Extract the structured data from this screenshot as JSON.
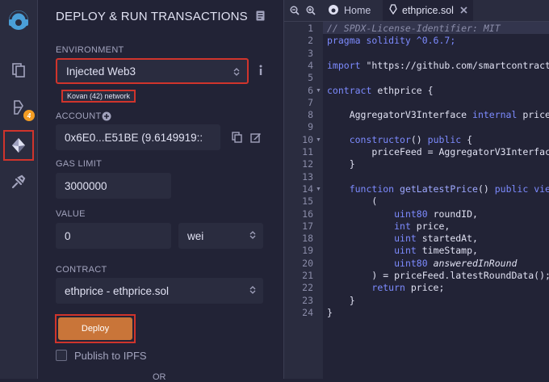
{
  "sidebar": {
    "icons": [
      "logo-icon",
      "file-explorer-icon",
      "compiler-icon",
      "deploy-run-icon",
      "plugin-icon"
    ],
    "compiler_badge": "4",
    "accent": "#c97539",
    "highlight": "#d0342c"
  },
  "panel": {
    "title": "DEPLOY & RUN TRANSACTIONS",
    "environment": {
      "label": "ENVIRONMENT",
      "value": "Injected Web3",
      "network": "Kovan (42) network"
    },
    "account": {
      "label": "ACCOUNT",
      "value": "0x6E0...E51BE (9.6149919::"
    },
    "gas_limit": {
      "label": "GAS LIMIT",
      "value": "3000000"
    },
    "value": {
      "label": "VALUE",
      "amount": "0",
      "unit": "wei"
    },
    "contract": {
      "label": "CONTRACT",
      "value": "ethprice - ethprice.sol"
    },
    "deploy_label": "Deploy",
    "publish_label": "Publish to IPFS",
    "or_label": "OR"
  },
  "editor": {
    "tabs": [
      {
        "label": "Home"
      },
      {
        "label": "ethprice.sol"
      }
    ],
    "line_numbers": [
      "1",
      "2",
      "3",
      "4",
      "5",
      "6",
      "7",
      "8",
      "9",
      "10",
      "11",
      "12",
      "13",
      "14",
      "15",
      "16",
      "17",
      "18",
      "19",
      "20",
      "21",
      "22",
      "23",
      "24"
    ],
    "lines": [
      {
        "parts": [
          {
            "t": "// SPDX-License-Identifier: MIT",
            "c": "cm"
          }
        ]
      },
      {
        "parts": [
          {
            "t": "pragma solidity",
            "c": "kw"
          },
          {
            "t": " ^0.6.7;",
            "c": "kw"
          }
        ]
      },
      {
        "parts": [
          {
            "t": "",
            "c": ""
          }
        ]
      },
      {
        "parts": [
          {
            "t": "import",
            "c": "kw"
          },
          {
            "t": " \"https://github.com/smartcontract",
            "c": ""
          }
        ]
      },
      {
        "parts": [
          {
            "t": "",
            "c": ""
          }
        ]
      },
      {
        "parts": [
          {
            "t": "contract",
            "c": "kw"
          },
          {
            "t": " ethprice {",
            "c": ""
          }
        ]
      },
      {
        "parts": [
          {
            "t": "",
            "c": ""
          }
        ]
      },
      {
        "parts": [
          {
            "t": "    AggregatorV3Interface ",
            "c": ""
          },
          {
            "t": "internal",
            "c": "kw"
          },
          {
            "t": " price",
            "c": ""
          }
        ]
      },
      {
        "parts": [
          {
            "t": "",
            "c": ""
          }
        ]
      },
      {
        "parts": [
          {
            "t": "    ",
            "c": ""
          },
          {
            "t": "constructor",
            "c": "kw"
          },
          {
            "t": "() ",
            "c": ""
          },
          {
            "t": "public",
            "c": "kw"
          },
          {
            "t": " {",
            "c": ""
          }
        ]
      },
      {
        "parts": [
          {
            "t": "        priceFeed = AggregatorV3Interfac",
            "c": ""
          }
        ]
      },
      {
        "parts": [
          {
            "t": "    }",
            "c": ""
          }
        ]
      },
      {
        "parts": [
          {
            "t": "",
            "c": ""
          }
        ]
      },
      {
        "parts": [
          {
            "t": "    ",
            "c": ""
          },
          {
            "t": "function",
            "c": "kw"
          },
          {
            "t": " getLatestPrice",
            "c": "ty"
          },
          {
            "t": "() ",
            "c": ""
          },
          {
            "t": "public",
            "c": "kw"
          },
          {
            "t": " vie",
            "c": "kw"
          }
        ]
      },
      {
        "parts": [
          {
            "t": "        (",
            "c": ""
          }
        ]
      },
      {
        "parts": [
          {
            "t": "            ",
            "c": ""
          },
          {
            "t": "uint80",
            "c": "kw"
          },
          {
            "t": " roundID,",
            "c": ""
          }
        ]
      },
      {
        "parts": [
          {
            "t": "            ",
            "c": ""
          },
          {
            "t": "int",
            "c": "kw"
          },
          {
            "t": " price,",
            "c": ""
          }
        ]
      },
      {
        "parts": [
          {
            "t": "            ",
            "c": ""
          },
          {
            "t": "uint",
            "c": "kw"
          },
          {
            "t": " startedAt,",
            "c": ""
          }
        ]
      },
      {
        "parts": [
          {
            "t": "            ",
            "c": ""
          },
          {
            "t": "uint",
            "c": "kw"
          },
          {
            "t": " timeStamp,",
            "c": ""
          }
        ]
      },
      {
        "parts": [
          {
            "t": "            ",
            "c": ""
          },
          {
            "t": "uint80",
            "c": "kw"
          },
          {
            "t": " answeredInRound",
            "c": "it"
          }
        ]
      },
      {
        "parts": [
          {
            "t": "        ) = priceFeed.latestRoundData();",
            "c": ""
          }
        ]
      },
      {
        "parts": [
          {
            "t": "        ",
            "c": ""
          },
          {
            "t": "return",
            "c": "kw"
          },
          {
            "t": " price;",
            "c": ""
          }
        ]
      },
      {
        "parts": [
          {
            "t": "    }",
            "c": ""
          }
        ]
      },
      {
        "parts": [
          {
            "t": "}",
            "c": ""
          }
        ]
      }
    ]
  }
}
